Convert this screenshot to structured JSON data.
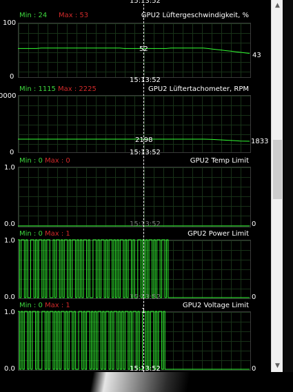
{
  "panels": [
    {
      "title": "GPU2 Lüftergeschwindigkeit, %",
      "min_label": "Min : 24",
      "max_label": "Max : 53",
      "y_max_label": "100",
      "y_min_label": "0",
      "time_top": "15:13:52",
      "time_bottom": "15:13:52",
      "cursor_value": "52",
      "current_value": "43",
      "y_range": [
        0,
        100
      ]
    },
    {
      "title": "GPU2 Lüftertachometer, RPM",
      "min_label": "Min : 1115",
      "max_label": "Max : 2225",
      "y_max_label": "0000",
      "y_min_label": "0",
      "time_top": "15:13:52",
      "time_bottom": "15:13:52",
      "cursor_value": "2198",
      "current_value": "1833",
      "y_range": [
        0,
        10000
      ]
    },
    {
      "title": "GPU2 Temp Limit",
      "min_label": "Min : 0",
      "max_label": "Max : 0",
      "y_max_label": "1.0",
      "y_min_label": "0.0",
      "time_bottom": "15:13:52",
      "cursor_value": "0",
      "current_value": "0",
      "y_range": [
        0,
        1
      ]
    },
    {
      "title": "GPU2 Power Limit",
      "min_label": "Min : 0",
      "max_label": "Max : 1",
      "y_max_label": "1.0",
      "y_min_label": "0.0",
      "time_bottom": "15:13:52",
      "cursor_value": "0",
      "current_value": "0",
      "y_range": [
        0,
        1
      ]
    },
    {
      "title": "GPU2 Voltage Limit",
      "min_label": "Min : 0",
      "max_label": "Max : 1",
      "y_max_label": "1.0",
      "y_min_label": "0.0",
      "time_bottom": "15:13:52",
      "cursor_value": "1",
      "current_value": "0",
      "y_range": [
        0,
        1
      ]
    }
  ],
  "series": {
    "fan_percent": [
      52,
      52,
      52,
      52,
      52,
      53,
      53,
      53,
      53,
      53,
      53,
      53,
      53,
      53,
      53,
      53,
      53,
      53,
      53,
      53,
      53,
      53,
      53,
      52,
      52,
      52,
      52,
      52,
      52,
      52,
      52,
      52,
      52,
      53,
      53,
      53,
      53,
      53,
      53,
      53,
      53,
      52,
      51,
      50,
      49,
      48,
      47,
      46,
      45,
      44,
      43
    ],
    "fan_rpm": [
      2198,
      2198,
      2198,
      2198,
      2198,
      2198,
      2198,
      2198,
      2198,
      2198,
      2198,
      2198,
      2198,
      2198,
      2198,
      2198,
      2198,
      2198,
      2198,
      2198,
      2198,
      2198,
      2198,
      2198,
      2198,
      2198,
      2198,
      2198,
      2198,
      2198,
      2198,
      2198,
      2198,
      2198,
      2198,
      2198,
      2198,
      2198,
      2198,
      2198,
      2198,
      2180,
      2150,
      2110,
      2060,
      2010,
      1960,
      1910,
      1870,
      1845,
      1833
    ],
    "temp_limit": [
      0,
      0,
      0,
      0,
      0,
      0,
      0,
      0,
      0,
      0,
      0,
      0,
      0,
      0,
      0,
      0,
      0,
      0,
      0,
      0,
      0,
      0,
      0,
      0,
      0,
      0,
      0,
      0,
      0,
      0,
      0,
      0,
      0,
      0,
      0,
      0,
      0,
      0,
      0,
      0,
      0,
      0,
      0,
      0,
      0,
      0,
      0,
      0,
      0,
      0,
      0
    ],
    "power_limit": [
      1,
      0,
      1,
      1,
      0,
      1,
      0,
      0,
      1,
      1,
      0,
      1,
      0,
      1,
      1,
      0,
      1,
      0,
      1,
      1,
      0,
      0,
      1,
      0,
      1,
      1,
      0,
      1,
      0,
      1,
      1,
      0,
      1,
      0,
      1,
      1,
      0,
      1,
      0,
      1,
      0,
      1,
      1,
      0,
      1,
      0,
      0,
      1,
      1,
      0,
      1,
      0,
      1,
      1,
      0,
      1,
      0,
      1,
      1,
      0,
      1,
      0,
      1,
      0,
      1,
      1,
      0,
      1,
      0,
      1,
      1,
      0,
      1,
      0,
      0,
      1,
      1,
      0,
      1,
      0,
      1,
      0,
      1,
      1,
      0,
      1,
      0,
      1,
      1,
      0,
      1,
      1,
      0,
      1,
      0,
      0,
      0,
      0,
      0,
      0,
      0,
      0,
      0,
      0,
      0,
      0,
      0,
      0,
      0,
      0,
      0,
      0,
      0,
      0,
      0,
      0
    ],
    "voltage_limit": [
      1,
      0,
      1,
      0,
      1,
      1,
      0,
      1,
      0,
      1,
      1,
      0,
      1,
      0,
      0,
      1,
      1,
      0,
      1,
      0,
      1,
      1,
      0,
      1,
      0,
      1,
      0,
      1,
      1,
      0,
      1,
      0,
      1,
      1,
      0,
      1,
      0,
      0,
      1,
      1,
      0,
      1,
      0,
      1,
      1,
      0,
      1,
      0,
      1,
      0,
      1,
      1,
      0,
      1,
      0,
      1,
      1,
      0,
      1,
      0,
      1,
      1,
      0,
      1,
      0,
      1,
      0,
      1,
      1,
      0,
      1,
      0,
      1,
      1,
      0,
      1,
      0,
      0,
      1,
      1,
      0,
      1,
      0,
      1,
      1,
      0,
      1,
      0,
      1,
      1,
      0,
      1,
      0,
      0,
      0,
      0,
      0,
      0,
      0,
      0,
      0,
      0,
      0,
      0,
      0,
      0,
      0,
      0,
      0,
      0,
      0,
      0,
      0,
      0,
      0,
      0
    ]
  },
  "colors": {
    "trace": "#33ff33",
    "min": "#3ed83e",
    "max": "#d22a2a"
  },
  "scrollbar": {
    "up_icon": "▲",
    "down_icon": "▼"
  }
}
